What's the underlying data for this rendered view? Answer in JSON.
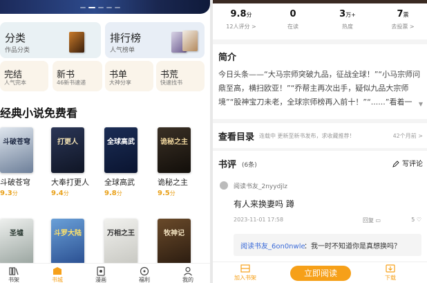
{
  "left": {
    "banner": {
      "dots": 5,
      "active_dot": 1
    },
    "categories": {
      "big": [
        {
          "label": "分类",
          "sub": "作品分类"
        },
        {
          "label": "排行榜",
          "sub": "人气榜单"
        }
      ],
      "small": [
        {
          "label": "完结",
          "sub": "人气完本"
        },
        {
          "label": "新书",
          "sub": "46新书速递"
        },
        {
          "label": "书单",
          "sub": "大神分享"
        },
        {
          "label": "书荒",
          "sub": "快速找书"
        }
      ]
    },
    "section_title": "经典小说免费看",
    "books_row1": [
      {
        "name": "斗破苍穹",
        "score": "9.3",
        "unit": "分",
        "cover_text": "斗破苍穹",
        "c1": "#dfe6ee",
        "c2": "#6d7f99",
        "tc": "#1f2a44"
      },
      {
        "name": "大奉打更人",
        "score": "9.4",
        "unit": "分",
        "cover_text": "打更人",
        "c1": "#2b3656",
        "c2": "#0f1525",
        "tc": "#f4e3b5"
      },
      {
        "name": "全球高武",
        "score": "9.8",
        "unit": "分",
        "cover_text": "全球高武",
        "c1": "#1b2d55",
        "c2": "#0a1430",
        "tc": "#ffffff"
      },
      {
        "name": "诡秘之主",
        "score": "9.5",
        "unit": "分",
        "cover_text": "诡秘之主",
        "c1": "#3a3025",
        "c2": "#120e0a",
        "tc": "#f3d9a0"
      }
    ],
    "books_row2": [
      {
        "cover_text": "圣墟",
        "c1": "#eef0ee",
        "c2": "#9aa5a0",
        "tc": "#2b3a33"
      },
      {
        "cover_text": "斗罗大陆",
        "c1": "#6aa0d8",
        "c2": "#2a4f91",
        "tc": "#ffe36b"
      },
      {
        "cover_text": "万相之王",
        "c1": "#f1f1ee",
        "c2": "#c8c8c2",
        "tc": "#333333"
      },
      {
        "cover_text": "牧神记",
        "c1": "#6a4a2a",
        "c2": "#2b1c10",
        "tc": "#f2e2c0"
      }
    ],
    "tabs": [
      {
        "label": "书架",
        "icon": "bookshelf-icon"
      },
      {
        "label": "书城",
        "icon": "bookstore-icon"
      },
      {
        "label": "漫画",
        "icon": "comic-icon"
      },
      {
        "label": "福利",
        "icon": "welfare-icon"
      },
      {
        "label": "我的",
        "icon": "profile-icon"
      }
    ]
  },
  "right": {
    "stats": [
      {
        "value": "9.8",
        "unit": "分",
        "label": "12人评分 >"
      },
      {
        "value": "0",
        "unit": "",
        "label": "在读"
      },
      {
        "value": "3",
        "unit": "万+",
        "label": "热度"
      },
      {
        "value": "7",
        "unit": "票",
        "label": "去投票 >"
      }
    ],
    "intro": {
      "title": "简介",
      "text": "今日头条——“大马宗师突破九品，征战全球！”“小马宗师问鼎至高，横扫欧亚！”“乔帮主再次出手，疑似九品大宗师境”“股神宝刀未老，全球宗师榜再入前十！”“......”看着一"
    },
    "catalog": {
      "title": "查看目录",
      "status": "连载中 更新至新书发布，求收藏推荐！",
      "time": "42个月前 >"
    },
    "reviews": {
      "title": "书评",
      "count": "(6条)",
      "write": "写评论",
      "items": [
        {
          "user": "阅读书友_2nyydjlz",
          "text": "有人来换妻吗 蹲",
          "time": "2023-11-01 17:58",
          "reply_label": "回复",
          "likes": "5",
          "reply": {
            "user": "阅读书友_6on0nwle",
            "text": "：我一时不知道你是真想换吗？"
          }
        }
      ]
    },
    "bottom": {
      "shelf": "加入书架",
      "read": "立即阅读",
      "download": "下载"
    }
  }
}
